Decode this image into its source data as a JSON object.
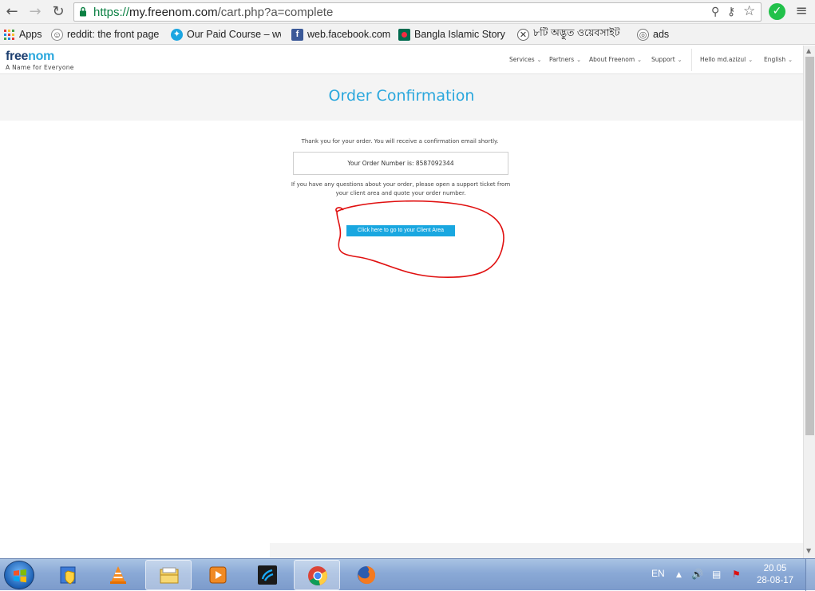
{
  "browser": {
    "url_scheme": "https://",
    "url_host": "my.freenom.com",
    "url_path": "/cart.php?a=complete",
    "bookmarks": [
      {
        "label": "Apps",
        "icon": "apps-grid-icon"
      },
      {
        "label": "reddit: the front page",
        "icon": "reddit-icon"
      },
      {
        "label": "Our Paid Course – ww",
        "icon": "telenor-icon"
      },
      {
        "label": "web.facebook.com",
        "icon": "facebook-icon"
      },
      {
        "label": "Bangla Islamic Story |",
        "icon": "bangladesh-flag-icon"
      },
      {
        "label": "৮টি অদ্ভুত ওয়েবসাইট",
        "icon": "site-icon"
      },
      {
        "label": "ads",
        "icon": "target-icon"
      }
    ]
  },
  "site": {
    "logo_main": "free",
    "logo_accent": "nom",
    "tagline": "A Name for Everyone",
    "nav": [
      {
        "label": "Services"
      },
      {
        "label": "Partners"
      },
      {
        "label": "About Freenom"
      },
      {
        "label": "Support"
      },
      {
        "label": "Hello md.azizul"
      },
      {
        "label": "English"
      }
    ]
  },
  "order": {
    "title": "Order Confirmation",
    "thanks_text": "Thank you for your order. You will receive a confirmation email shortly.",
    "order_number_text": "Your Order Number is: 8587092344",
    "questions_text": "If you have any questions about your order, please open a support ticket from your client area and quote your order number.",
    "client_area_button": "Click here to go to your Client Area"
  },
  "colors": {
    "accent": "#2aa7dd",
    "button": "#19a7e0",
    "annotation": "#e01010",
    "logo_dark": "#1d3f70"
  },
  "taskbar": {
    "apps": [
      {
        "name": "explorer-shield-icon",
        "active": false
      },
      {
        "name": "vlc-icon",
        "active": false
      },
      {
        "name": "file-explorer-icon",
        "active": true
      },
      {
        "name": "media-player-icon",
        "active": false
      },
      {
        "name": "telenor-app-icon",
        "active": false
      },
      {
        "name": "chrome-icon",
        "active": true
      },
      {
        "name": "firefox-icon",
        "active": false
      }
    ],
    "language": "EN",
    "time": "20.05",
    "date": "28-08-17"
  }
}
